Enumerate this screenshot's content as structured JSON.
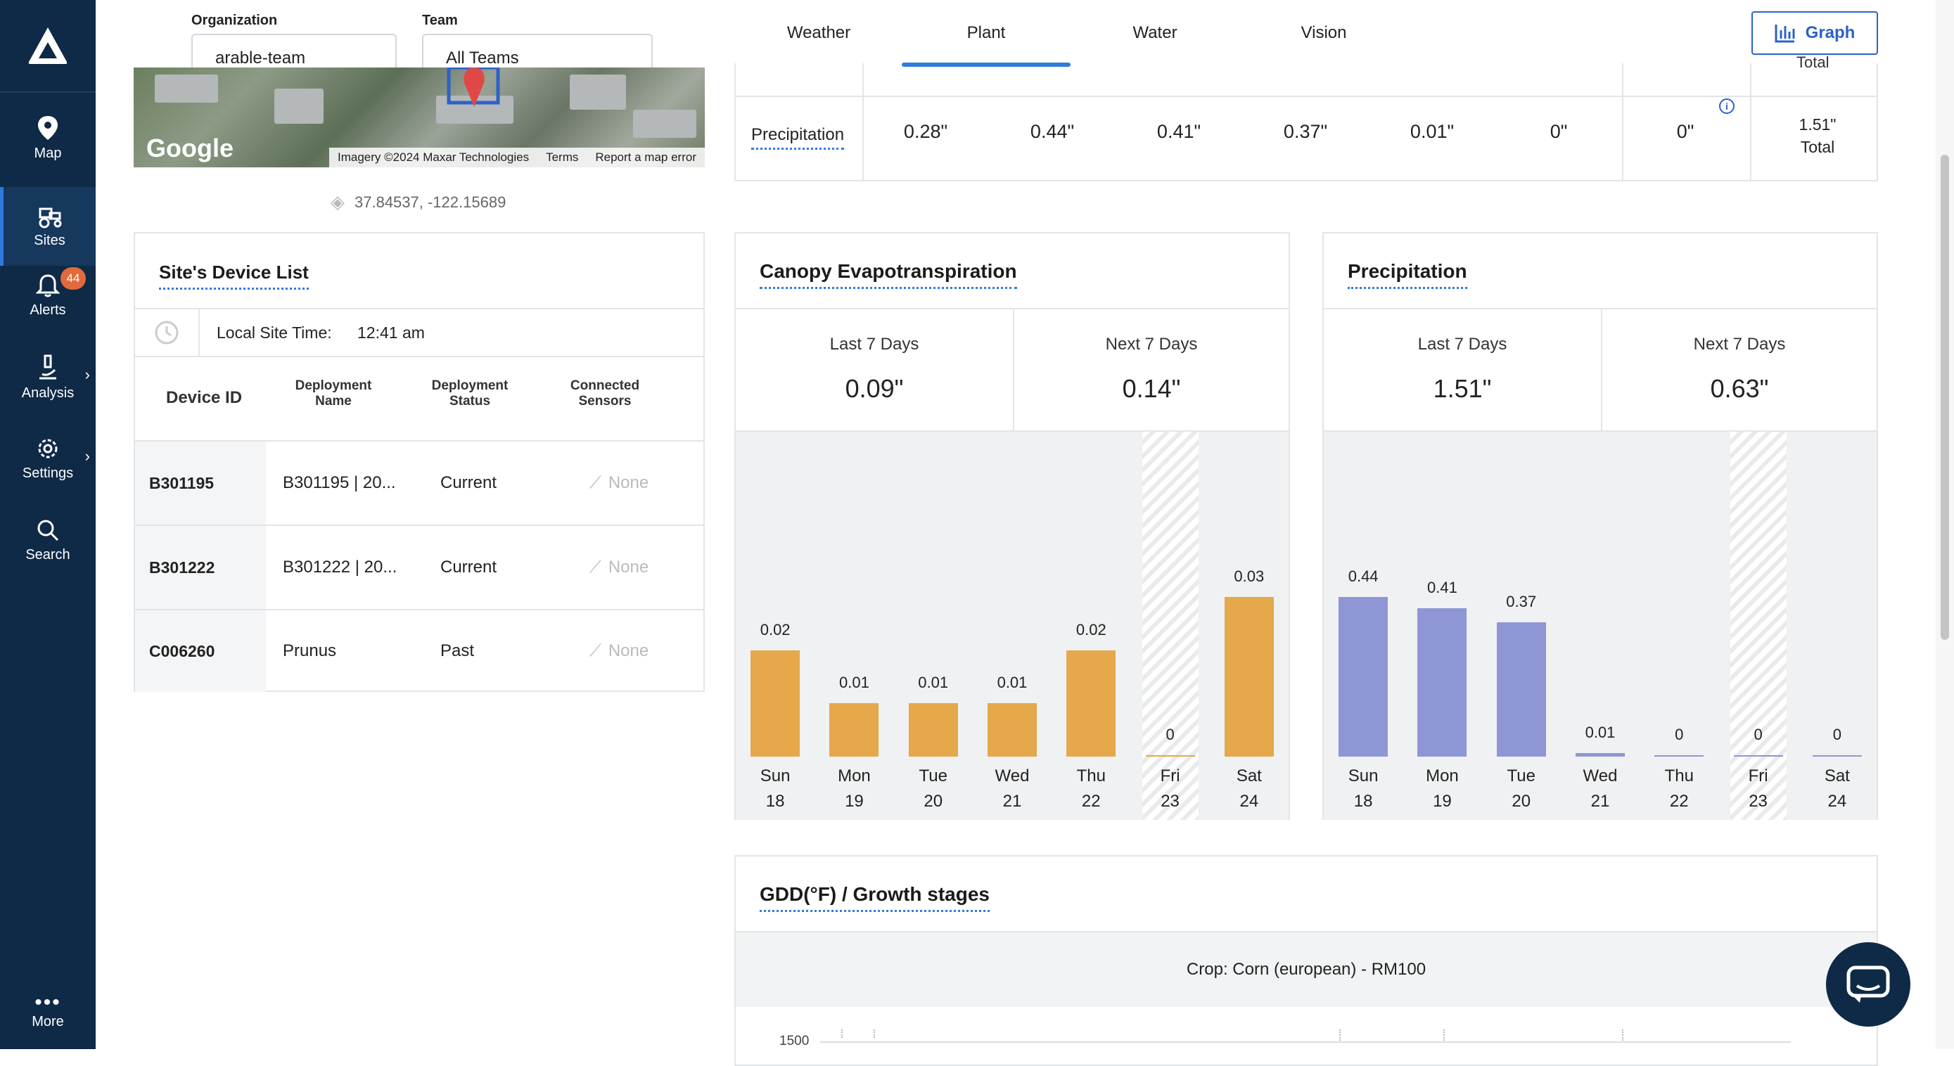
{
  "sidebar": {
    "items": [
      {
        "label": "Map",
        "icon": "map-pin-icon"
      },
      {
        "label": "Sites",
        "icon": "tractor-icon"
      },
      {
        "label": "Alerts",
        "icon": "bell-icon",
        "badge": "44"
      },
      {
        "label": "Analysis",
        "icon": "microscope-icon"
      },
      {
        "label": "Settings",
        "icon": "gear-icon"
      },
      {
        "label": "Search",
        "icon": "search-icon"
      },
      {
        "label": "More",
        "icon": "more-dots-icon"
      }
    ]
  },
  "filters": {
    "organization_label": "Organization",
    "organization_value": "arable-team",
    "team_label": "Team",
    "team_value": "All Teams"
  },
  "map": {
    "google": "Google",
    "imagery": "Imagery ©2024 Maxar Technologies",
    "terms": "Terms",
    "report": "Report a map error",
    "coords": "37.84537, -122.15689"
  },
  "device_list": {
    "title": "Site's Device List",
    "local_time_label": "Local Site Time:",
    "local_time_value": "12:41 am",
    "headers": {
      "device_id": "Device ID",
      "deployment_name_1": "Deployment",
      "deployment_name_2": "Name",
      "deployment_status_1": "Deployment",
      "deployment_status_2": "Status",
      "connected_sensors_1": "Connected",
      "connected_sensors_2": "Sensors"
    },
    "rows": [
      {
        "id": "B301195",
        "name": "B301195 | 20...",
        "status": "Current",
        "sensors": "None"
      },
      {
        "id": "B301222",
        "name": "B301222 | 20...",
        "status": "Current",
        "sensors": "None"
      },
      {
        "id": "C006260",
        "name": "Prunus",
        "status": "Past",
        "sensors": "None"
      }
    ]
  },
  "tabs": {
    "weather": "Weather",
    "plant": "Plant",
    "water": "Water",
    "vision": "Vision",
    "active": "Plant",
    "graph_button": "Graph"
  },
  "precip_table": {
    "label": "Precipitation",
    "values": [
      "0.28\"",
      "0.44\"",
      "0.41\"",
      "0.37\"",
      "0.01\"",
      "0\""
    ],
    "today": "0\"",
    "total_value": "1.51\"",
    "total_label": "Total",
    "total_label_top": "Total"
  },
  "canopy_et": {
    "title": "Canopy Evapotranspiration",
    "last_label": "Last 7 Days",
    "last_value": "0.09\"",
    "next_label": "Next 7 Days",
    "next_value": "0.14\"",
    "chart_data": {
      "type": "bar",
      "categories": [
        "Sun 18",
        "Mon 19",
        "Tue 20",
        "Wed 21",
        "Thu 22",
        "Fri 23",
        "Sat 24"
      ],
      "values": [
        0.02,
        0.01,
        0.01,
        0.01,
        0.02,
        0,
        0.03
      ],
      "labels": [
        "0.02",
        "0.01",
        "0.01",
        "0.01",
        "0.02",
        "0",
        "0.03"
      ],
      "days": [
        "Sun",
        "Mon",
        "Tue",
        "Wed",
        "Thu",
        "Fri",
        "Sat"
      ],
      "dates": [
        "18",
        "19",
        "20",
        "21",
        "22",
        "23",
        "24"
      ],
      "highlight_index": 5,
      "ymax": 0.045,
      "color": "#e5a84a"
    }
  },
  "precipitation": {
    "title": "Precipitation",
    "last_label": "Last 7 Days",
    "last_value": "1.51\"",
    "next_label": "Next 7 Days",
    "next_value": "0.63\"",
    "chart_data": {
      "type": "bar",
      "categories": [
        "Sun 18",
        "Mon 19",
        "Tue 20",
        "Wed 21",
        "Thu 22",
        "Fri 23",
        "Sat 24"
      ],
      "values": [
        0.44,
        0.41,
        0.37,
        0.01,
        0,
        0,
        0
      ],
      "labels": [
        "0.44",
        "0.41",
        "0.37",
        "0.01",
        "0",
        "0",
        "0"
      ],
      "days": [
        "Sun",
        "Mon",
        "Tue",
        "Wed",
        "Thu",
        "Fri",
        "Sat"
      ],
      "dates": [
        "18",
        "19",
        "20",
        "21",
        "22",
        "23",
        "24"
      ],
      "highlight_index": 5,
      "ymax": 0.66,
      "color": "#8f96d6"
    }
  },
  "gdd": {
    "title": "GDD(°F) / Growth stages",
    "crop": "Crop: Corn (european) - RM100",
    "y_tick": "1500"
  }
}
